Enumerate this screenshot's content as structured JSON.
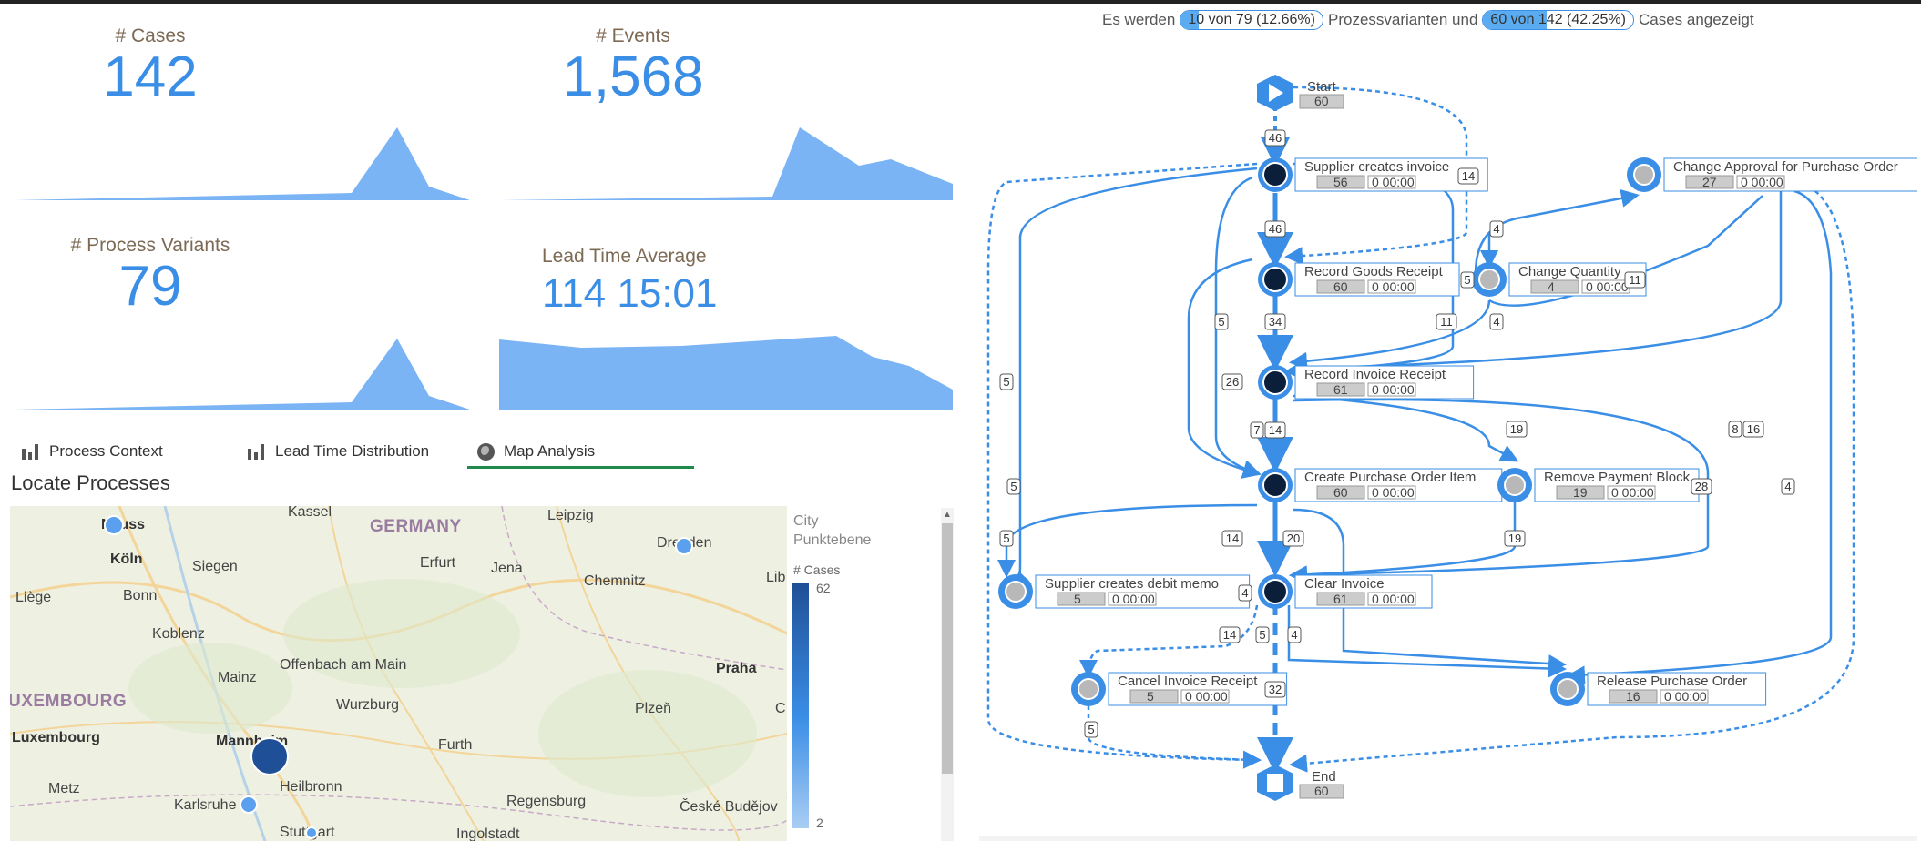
{
  "kpis": {
    "cases": {
      "title": "# Cases",
      "value": "142"
    },
    "events": {
      "title": "# Events",
      "value": "1,568"
    },
    "variants": {
      "title": "# Process Variants",
      "value": "79"
    },
    "lead_time": {
      "title": "Lead Time Average",
      "value": "114 15:01"
    }
  },
  "tabs": [
    {
      "label": "Process Context",
      "icon": "bar-chart-icon"
    },
    {
      "label": "Lead Time Distribution",
      "icon": "bar-chart-icon"
    },
    {
      "label": "Map Analysis",
      "icon": "globe-icon"
    }
  ],
  "active_tab": "Map Analysis",
  "locate_title": "Locate Processes",
  "map": {
    "labels": [
      "Neuss",
      "Kassel",
      "GERMANY",
      "Leipzig",
      "Dresden",
      "Köln",
      "Siegen",
      "Erfurt",
      "Jena",
      "Chemnitz",
      "Lib",
      "Liège",
      "Bonn",
      "Koblenz",
      "Mainz",
      "Offenbach am Main",
      "Praha",
      "UXEMBOURG",
      "Wurzburg",
      "Plzeň",
      "C",
      "Luxembourg",
      "Mannheim",
      "Furth",
      "Metz",
      "Heilbronn",
      "Karlsruhe",
      "Regensburg",
      "České Budějov",
      "Stuttgart",
      "Ingolstadt"
    ],
    "legend_title": "City",
    "legend_subtitle": "Punktebene",
    "legend_measure": "# Cases",
    "legend_max": "62",
    "legend_min": "2",
    "colors": {
      "dark": "#1f4f96",
      "light": "#5aa0ee"
    }
  },
  "process": {
    "header_prefix": "Es werden",
    "variants_pill": "10 von 79 (12.66%)",
    "variants_fraction": 0.1266,
    "header_middle": "Prozessvarianten und",
    "cases_pill": "60 von 142 (42.25%)",
    "cases_fraction": 0.4225,
    "header_suffix": "Cases angezeigt",
    "start": {
      "label": "Start",
      "count": "60"
    },
    "end": {
      "label": "End",
      "count": "60"
    },
    "nodes": [
      {
        "label": "Supplier creates invoice",
        "count": "56",
        "time": "0 00:00"
      },
      {
        "label": "Change Approval for Purchase Order",
        "count": "27",
        "time": "0 00:00"
      },
      {
        "label": "Record Goods Receipt",
        "count": "60",
        "time": "0 00:00"
      },
      {
        "label": "Change Quantity",
        "count": "4",
        "time": "0 00:00"
      },
      {
        "label": "Record Invoice Receipt",
        "count": "61",
        "time": "0 00:00"
      },
      {
        "label": "Create Purchase Order Item",
        "count": "60",
        "time": "0 00:00"
      },
      {
        "label": "Remove Payment Block",
        "count": "19",
        "time": "0 00:00"
      },
      {
        "label": "Supplier creates debit memo",
        "count": "5",
        "time": "0 00:00"
      },
      {
        "label": "Clear Invoice",
        "count": "61",
        "time": "0 00:00"
      },
      {
        "label": "Cancel Invoice Receipt",
        "count": "5",
        "time": "0 00:00"
      },
      {
        "label": "Release Purchase Order",
        "count": "16",
        "time": "0 00:00"
      }
    ],
    "edge_labels": [
      "46",
      "14",
      "46",
      "4",
      "5",
      "11",
      "5",
      "11",
      "34",
      "4",
      "26",
      "5",
      "7",
      "14",
      "19",
      "8",
      "16",
      "28",
      "5",
      "5",
      "14",
      "20",
      "19",
      "4",
      "14",
      "5",
      "4",
      "32",
      "5",
      "4"
    ]
  }
}
